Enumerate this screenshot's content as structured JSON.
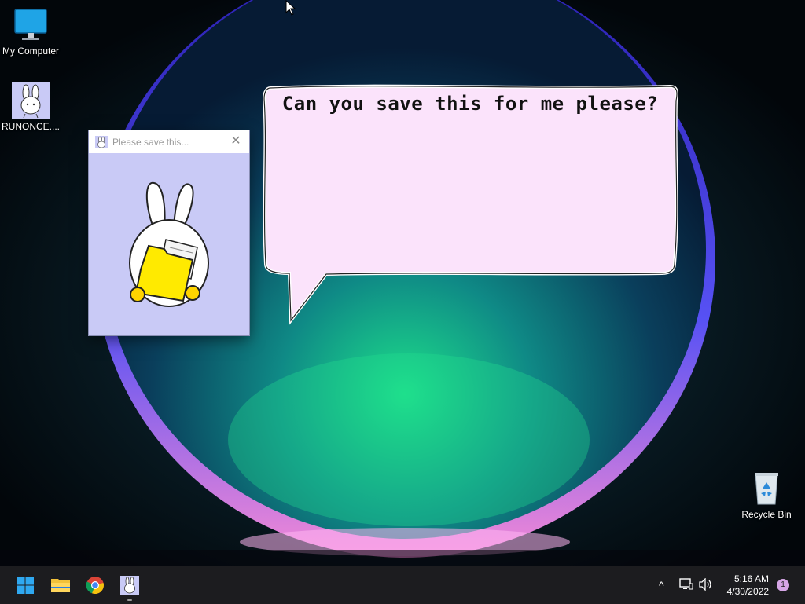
{
  "desktop": {
    "icons": [
      {
        "label": "My Computer",
        "icon": "monitor-icon"
      },
      {
        "label": "RUNONCE....",
        "icon": "bunny-app-icon"
      },
      {
        "label": "Recycle Bin",
        "icon": "recycle-bin-icon"
      }
    ]
  },
  "window": {
    "title": "Please save this...",
    "close_glyph": "✕",
    "icon": "bunny-app-icon",
    "background_color": "#c9caf6"
  },
  "bubble": {
    "text": "Can you save this for me please?",
    "fill_color": "#fbe3fb"
  },
  "taskbar": {
    "apps": [
      {
        "name": "start",
        "icon": "windows-start-icon"
      },
      {
        "name": "file-explorer",
        "icon": "folder-icon"
      },
      {
        "name": "chrome",
        "icon": "chrome-icon"
      },
      {
        "name": "bunny-app",
        "icon": "bunny-app-icon",
        "running": true
      }
    ],
    "tray": {
      "chevron": "^",
      "network": "network-icon",
      "volume": "speaker-icon"
    },
    "clock": {
      "time": "5:16 AM",
      "date": "4/30/2022"
    },
    "notifications": "1"
  }
}
